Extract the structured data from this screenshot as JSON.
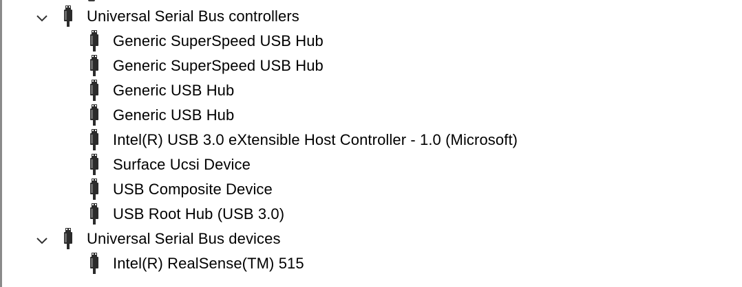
{
  "tree": {
    "categories": [
      {
        "label": "Universal Serial Bus controllers",
        "expanded": true,
        "icon": "usb-plug-icon",
        "devices": [
          {
            "label": "Generic SuperSpeed USB Hub",
            "icon": "usb-plug-icon"
          },
          {
            "label": "Generic SuperSpeed USB Hub",
            "icon": "usb-plug-icon"
          },
          {
            "label": "Generic USB Hub",
            "icon": "usb-plug-icon"
          },
          {
            "label": "Generic USB Hub",
            "icon": "usb-plug-icon"
          },
          {
            "label": "Intel(R) USB 3.0 eXtensible Host Controller - 1.0 (Microsoft)",
            "icon": "usb-plug-icon"
          },
          {
            "label": "Surface Ucsi Device",
            "icon": "usb-plug-icon"
          },
          {
            "label": "USB Composite Device",
            "icon": "usb-plug-icon"
          },
          {
            "label": "USB Root Hub (USB 3.0)",
            "icon": "usb-plug-icon"
          }
        ]
      },
      {
        "label": "Universal Serial Bus devices",
        "expanded": true,
        "icon": "usb-plug-icon",
        "devices": [
          {
            "label": "Intel(R) RealSense(TM) 515",
            "icon": "usb-plug-icon"
          }
        ]
      }
    ]
  },
  "colors": {
    "text": "#000000",
    "icon_dark": "#2b2b2b",
    "icon_mid": "#6b6b6b",
    "chevron": "#333333",
    "border": "#8a8a8a"
  }
}
